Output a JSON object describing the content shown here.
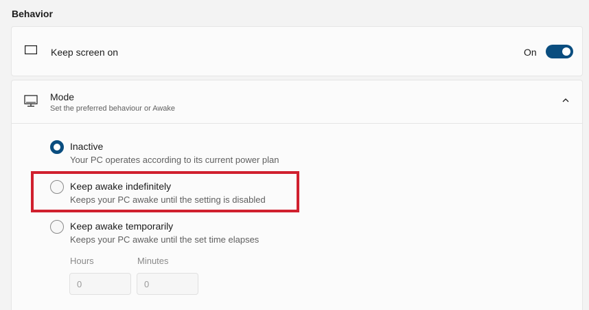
{
  "section": {
    "title": "Behavior"
  },
  "keep_screen": {
    "icon": "monitor-outline-icon",
    "title": "Keep screen on",
    "toggle_label": "On",
    "toggle_on": true
  },
  "mode": {
    "icon": "desktop-icon",
    "title": "Mode",
    "description": "Set the preferred behaviour or Awake",
    "expanded": true,
    "options": [
      {
        "title": "Inactive",
        "description": "Your PC operates according to its current power plan",
        "selected": true
      },
      {
        "title": "Keep awake indefinitely",
        "description": "Keeps your PC awake until the setting is disabled",
        "selected": false
      },
      {
        "title": "Keep awake temporarily",
        "description": "Keeps your PC awake until the set time elapses",
        "selected": false
      }
    ],
    "hours": {
      "label": "Hours",
      "value": "0"
    },
    "minutes": {
      "label": "Minutes",
      "value": "0"
    }
  },
  "colors": {
    "accent": "#0a4d7f",
    "highlight": "#d0202e"
  }
}
